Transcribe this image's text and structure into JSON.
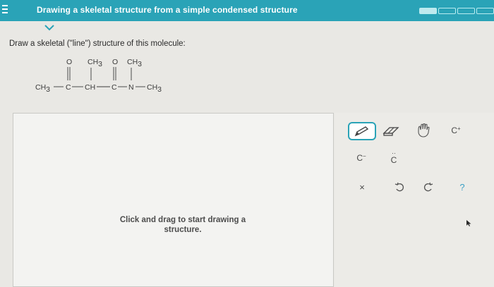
{
  "header": {
    "title": "Drawing a skeletal structure from a simple condensed structure",
    "progress_segments_total": 4,
    "progress_segments_done": 1,
    "accent_color": "#2aa3b7"
  },
  "question": {
    "prompt": "Draw a skeletal (\"line\") structure of this molecule:",
    "molecule": {
      "ch3_left": "CH",
      "c1": "C",
      "ch_mid": "CH",
      "c2": "C",
      "n": "N",
      "ch3_right": "CH",
      "o1": "O",
      "ch3_branch": "CH",
      "o2": "O",
      "ch3_n": "CH",
      "subscript": "3"
    }
  },
  "canvas": {
    "hint": "Click and drag to start drawing a structure."
  },
  "toolbox": {
    "carbanion_label": "C",
    "carbanion_charge": "−",
    "carbocation_label": "C",
    "carbocation_charge": "+",
    "carbene_label": "C",
    "carbene_dots": "··",
    "clear_label": "×",
    "help_label": "?",
    "icons": [
      "pencil-icon",
      "eraser-icon",
      "hand-icon",
      "undo-icon",
      "redo-icon"
    ]
  }
}
